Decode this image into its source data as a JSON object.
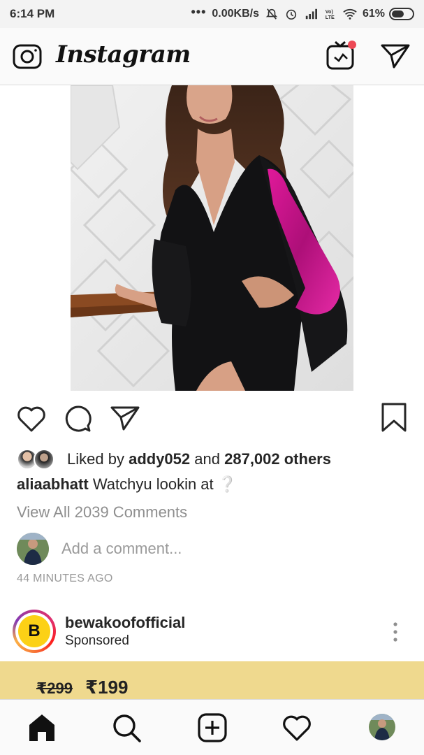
{
  "status_bar": {
    "time": "6:14 PM",
    "network_speed": "0.00KB/s",
    "battery_percent": "61%",
    "battery_level": 0.61
  },
  "header": {
    "app_name": "Instagram",
    "icons": [
      "camera-icon",
      "igtv-icon",
      "direct-message-icon"
    ],
    "igtv_notification_color": "#ed4956"
  },
  "post": {
    "liked_by_prefix": "Liked by",
    "liked_by_user": "addy052",
    "liked_by_and": "and",
    "likes_count": "287,002 others",
    "author": "aliaabhatt",
    "caption": "Watchyu lookin at",
    "caption_emoji": "❔",
    "view_comments": "View All 2039 Comments",
    "comment_placeholder": "Add a comment...",
    "time_ago": "44 MINUTES AGO"
  },
  "sponsored": {
    "account": "bewakoofofficial",
    "label": "Sponsored",
    "logo_letter": "B",
    "old_price": "₹299",
    "new_price": "₹199"
  },
  "bottom_nav": {
    "items": [
      "home-icon",
      "search-icon",
      "new-post-icon",
      "activity-icon",
      "profile-icon"
    ]
  },
  "colors": {
    "accent_blue": "#2fa7ea",
    "muted_text": "#8e8e8e",
    "ad_background": "#efd98e",
    "dress_pink": "#d4178f"
  }
}
